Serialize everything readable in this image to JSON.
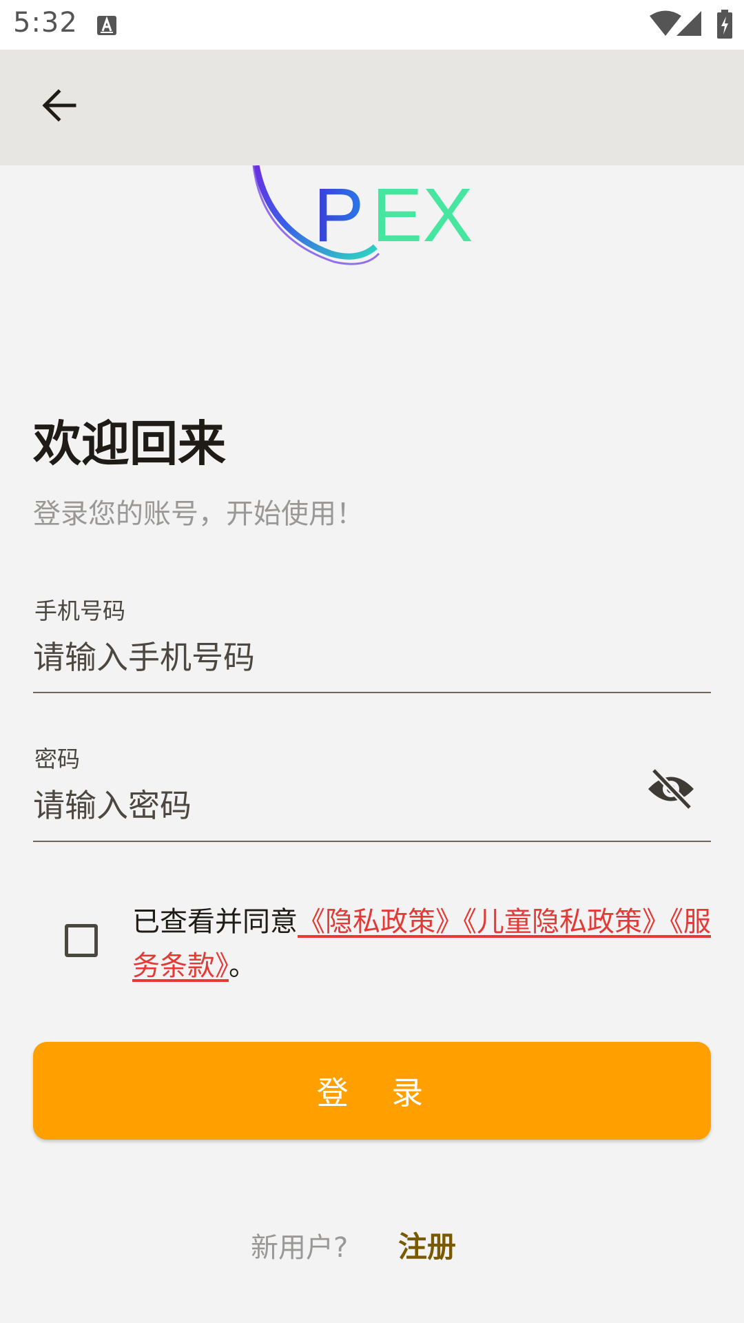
{
  "status_bar": {
    "time": "5:32",
    "icons": [
      "a-notification-icon",
      "wifi-icon",
      "signal-icon",
      "battery-charging-icon"
    ]
  },
  "app_bar": {
    "back_icon": "arrow-back-icon"
  },
  "logo": {
    "text": "PEX",
    "colors": [
      "#3a3ad8",
      "#2fd6c0",
      "#47e6a0"
    ]
  },
  "welcome": {
    "title": "欢迎回来",
    "subtitle": "登录您的账号，开始使用！"
  },
  "phone_field": {
    "label": "手机号码",
    "placeholder": "请输入手机号码",
    "value": ""
  },
  "password_field": {
    "label": "密码",
    "placeholder": "请输入密码",
    "value": "",
    "toggle_icon": "visibility-off-icon"
  },
  "agreement": {
    "checked": false,
    "prefix": "已查看并同意",
    "privacy_policy": "《隐私政策》",
    "child_privacy_policy": "《儿童隐私政策》",
    "terms_of_service": "《服务条款》",
    "suffix": "。",
    "link_color": "#e53935"
  },
  "login_button": {
    "label": "登 录",
    "color": "#ff9f00"
  },
  "register": {
    "prompt": "新用户?",
    "link_label": "注册"
  }
}
